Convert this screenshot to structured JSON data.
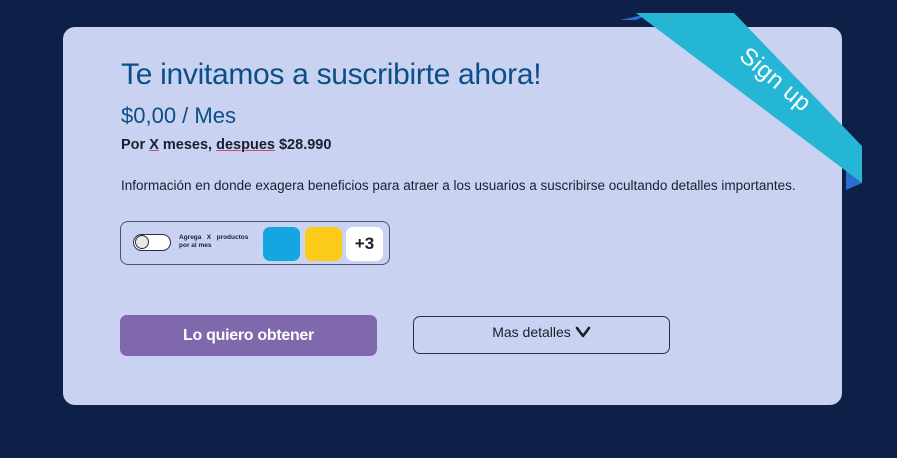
{
  "card": {
    "title": "Te invitamos a suscribirte ahora!",
    "price": "$0,00 / Mes",
    "terms": {
      "part1": "Por ",
      "x": "X",
      "part2": " meses, ",
      "despues": "despues",
      "part3": " $28.990"
    },
    "info": "Información en donde exagera beneficios para atraer a los usuarios a suscribirse ocultando detalles importantes."
  },
  "addon": {
    "toggle_label": "Agrega   X   productos\npor al mes",
    "toggle_on": false,
    "swatches": [
      "#14a6e0",
      "#fccb1a"
    ],
    "more_count": "+3"
  },
  "actions": {
    "primary_label": "Lo quiero obtener",
    "secondary_label": "Mas detalles",
    "secondary_icon": "chevron-down-icon"
  },
  "ribbon": {
    "label": "Sign up",
    "color": "#25b6d6",
    "fold_color": "#2a6fd0"
  },
  "colors": {
    "background": "#0f2048",
    "card": "#cad2f1",
    "title": "#0b4f86",
    "primary_button": "#7f68ac"
  }
}
